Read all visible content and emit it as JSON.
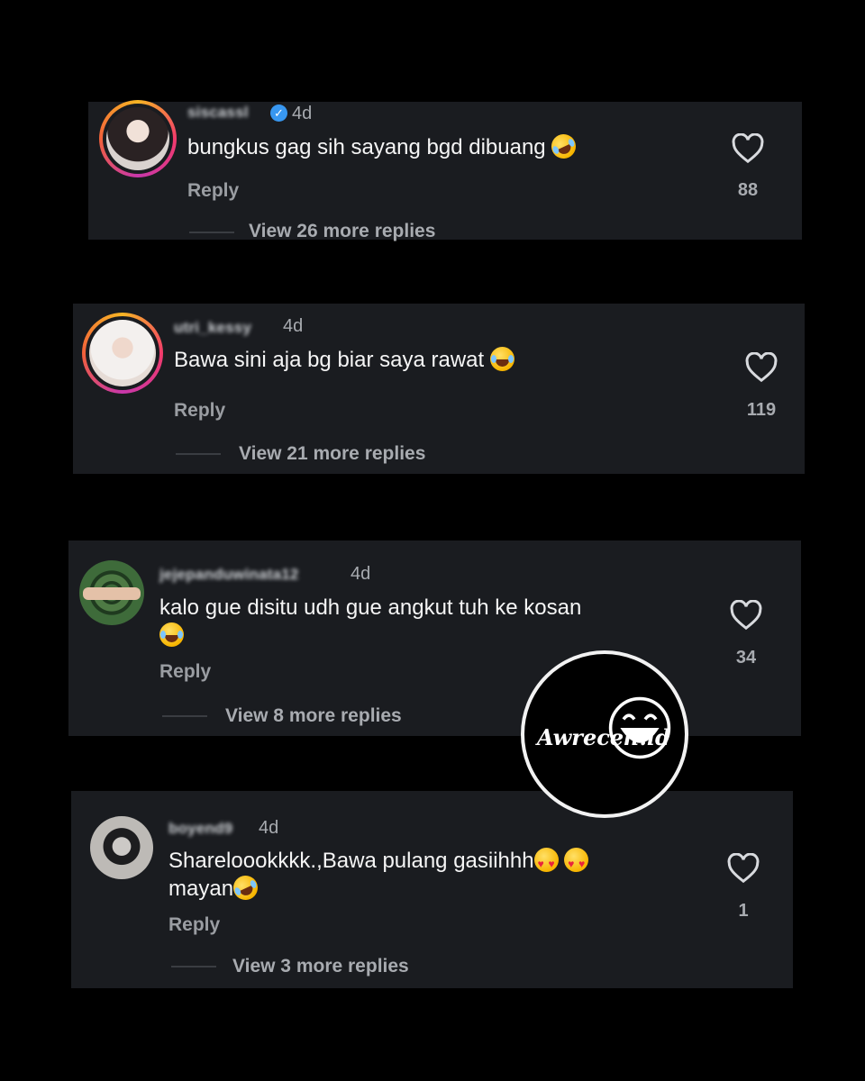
{
  "comments": [
    {
      "username": "siscassl",
      "verified": true,
      "time": "4d",
      "text": "bungkus gag sih sayang bgd dibuang",
      "emojis": [
        "rofl"
      ],
      "reply_label": "Reply",
      "likes": "88",
      "view_replies": "View 26 more replies"
    },
    {
      "username": "utri_kessy",
      "verified": false,
      "time": "4d",
      "text": "Bawa sini aja bg biar saya rawat",
      "emojis": [
        "laugh"
      ],
      "reply_label": "Reply",
      "likes": "119",
      "view_replies": "View 21 more replies"
    },
    {
      "username": "jejepanduwinata12",
      "verified": false,
      "time": "4d",
      "text": "kalo gue disitu udh gue angkut tuh ke kosan",
      "emojis": [
        "laugh"
      ],
      "reply_label": "Reply",
      "likes": "34",
      "view_replies": "View 8 more replies"
    },
    {
      "username": "boyend9",
      "verified": false,
      "time": "4d",
      "text_line1": "Shareloookkkk.,Bawa pulang gasiihhh",
      "text_line2": "mayan",
      "emojis": [
        "heart-eyes",
        "heart-eyes",
        "rofl"
      ],
      "reply_label": "Reply",
      "likes": "1",
      "view_replies": "View 3 more replies"
    }
  ],
  "watermark": {
    "text": "Awreceh.id",
    "icon": "laughing-face-icon"
  },
  "colors": {
    "background": "#000000",
    "card": "#1a1c20",
    "muted_text": "#a8abb0",
    "verified_blue": "#3897f0"
  }
}
